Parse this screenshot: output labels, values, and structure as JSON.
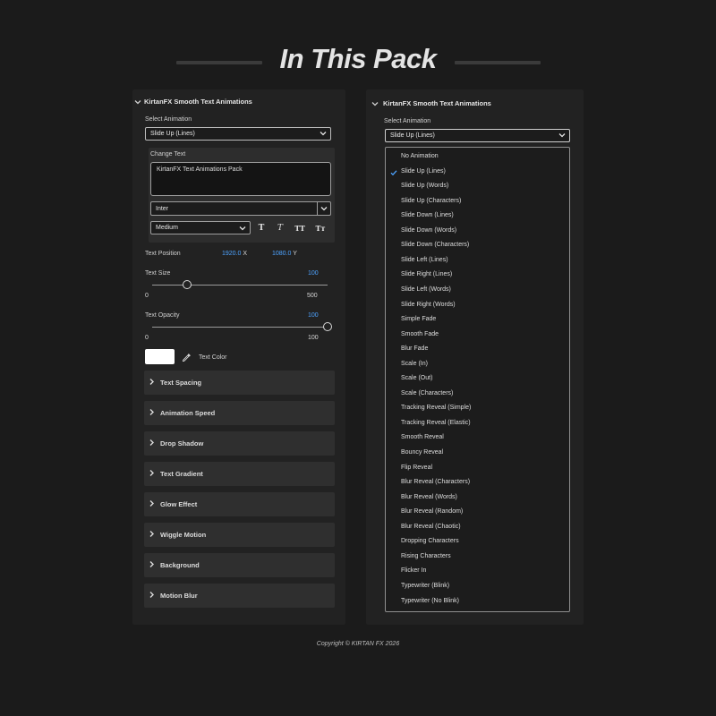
{
  "header": {
    "title": "In This Pack"
  },
  "left_panel": {
    "title": "KirtanFX Smooth Text Animations",
    "select_animation_label": "Select Animation",
    "select_animation_value": "Slide Up (Lines)",
    "change_text_label": "Change Text",
    "text_value": "KirtanFX Text Animations Pack",
    "font_value": "Inter",
    "weight_value": "Medium",
    "style_buttons": [
      "T",
      "T",
      "TT",
      "Tт"
    ],
    "text_position": {
      "label": "Text Position",
      "x_value": "1920.0",
      "x_unit": "X",
      "y_value": "1080.0",
      "y_unit": "Y"
    },
    "text_size": {
      "label": "Text Size",
      "value": "100",
      "min": "0",
      "max": "500",
      "level": 0.2
    },
    "text_opacity": {
      "label": "Text Opacity",
      "value": "100",
      "min": "0",
      "max": "100",
      "level": 1.0
    },
    "text_color": {
      "label": "Text Color",
      "color": "#ffffff"
    },
    "sections": [
      "Text Spacing",
      "Animation Speed",
      "Drop Shadow",
      "Text Gradient",
      "Glow Effect",
      "Wiggle Motion",
      "Background",
      "Motion Blur"
    ]
  },
  "right_panel": {
    "title": "KirtanFX Smooth Text Animations",
    "select_animation_label": "Select Animation",
    "select_animation_value": "Slide Up (Lines)",
    "options": [
      "No Animation",
      "Slide Up (Lines)",
      "Slide Up (Words)",
      "Slide Up (Characters)",
      "Slide Down (Lines)",
      "Slide Down (Words)",
      "Slide Down (Characters)",
      "Slide Left (Lines)",
      "Slide Right (Lines)",
      "Slide Left (Words)",
      "Slide Right (Words)",
      "Simple Fade",
      "Smooth Fade",
      "Blur Fade",
      "Scale (In)",
      "Scale (Out)",
      "Scale (Characters)",
      "Tracking Reveal (Simple)",
      "Tracking Reveal (Elastic)",
      "Smooth Reveal",
      "Bouncy Reveal",
      "Flip Reveal",
      "Blur Reveal (Characters)",
      "Blur Reveal (Words)",
      "Blur Reveal (Random)",
      "Blur Reveal (Chaotic)",
      "Dropping Characters",
      "Rising Characters",
      "Flicker In",
      "Typewriter (Blink)",
      "Typewriter (No Blink)"
    ],
    "selected_option": "Slide Up (Lines)"
  },
  "colors": {
    "accent": "#4da3ff",
    "background": "#1b1b1b",
    "panel": "#222222",
    "section": "#2f2f2f"
  },
  "footer": {
    "copyright": "Copyright © KIRTAN FX 2026"
  }
}
